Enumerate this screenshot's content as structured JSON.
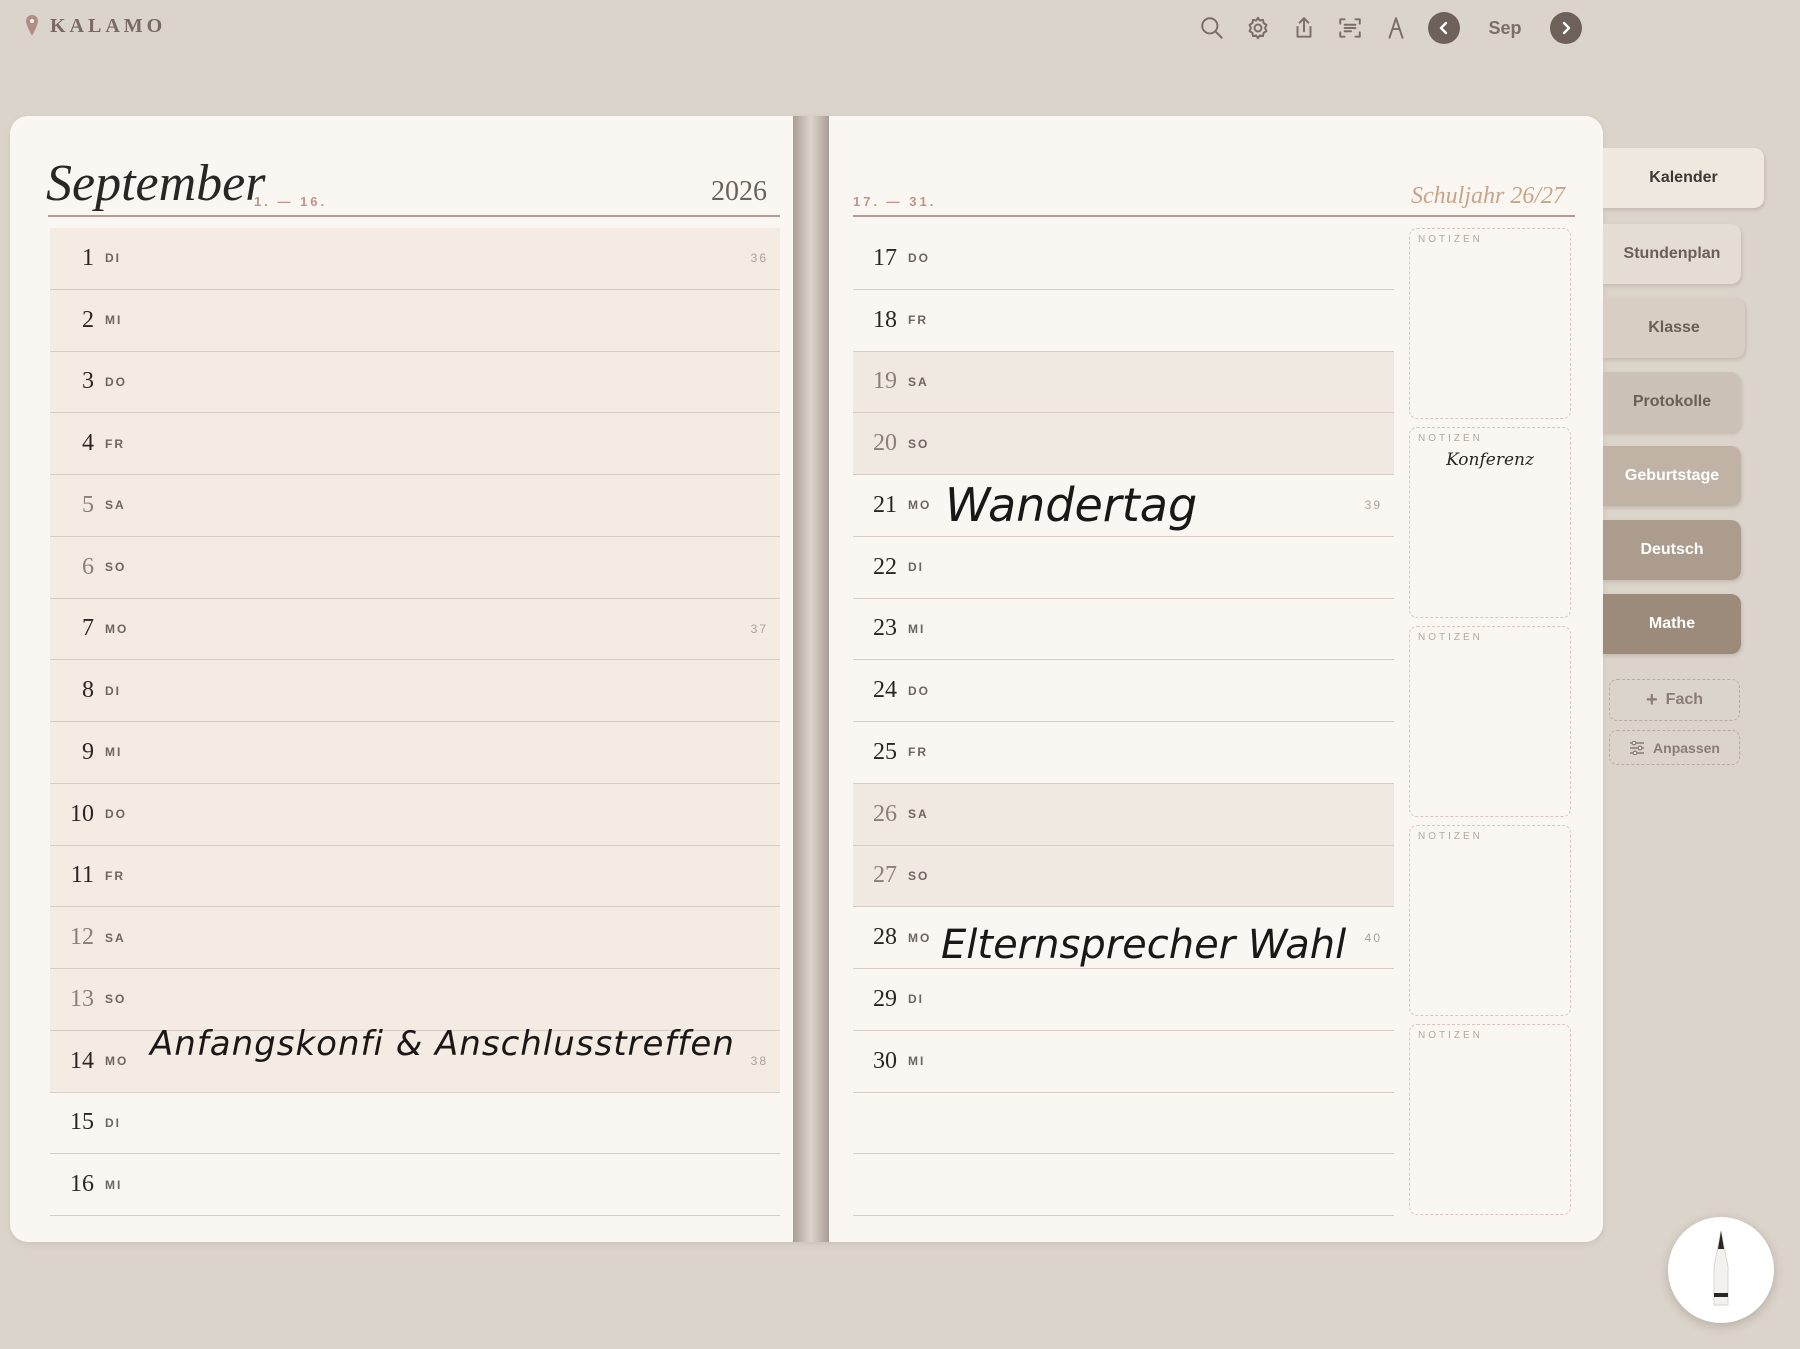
{
  "app": {
    "name": "KALAMO"
  },
  "toolbar": {
    "icons": [
      "search-icon",
      "settings-icon",
      "share-icon",
      "scan-icon",
      "pen-icon"
    ],
    "month": "Sep"
  },
  "left_page": {
    "month_title": "September",
    "range": "1. — 16.",
    "year": "2026",
    "days": [
      {
        "num": "1",
        "wd": "DI",
        "week": "36"
      },
      {
        "num": "2",
        "wd": "MI"
      },
      {
        "num": "3",
        "wd": "DO"
      },
      {
        "num": "4",
        "wd": "FR"
      },
      {
        "num": "5",
        "wd": "SA"
      },
      {
        "num": "6",
        "wd": "SO"
      },
      {
        "num": "7",
        "wd": "MO",
        "week": "37"
      },
      {
        "num": "8",
        "wd": "DI"
      },
      {
        "num": "9",
        "wd": "MI"
      },
      {
        "num": "10",
        "wd": "DO"
      },
      {
        "num": "11",
        "wd": "FR"
      },
      {
        "num": "12",
        "wd": "SA"
      },
      {
        "num": "13",
        "wd": "SO"
      },
      {
        "num": "14",
        "wd": "MO",
        "week": "38"
      },
      {
        "num": "15",
        "wd": "DI"
      },
      {
        "num": "16",
        "wd": "MI"
      }
    ],
    "handwriting_14": "Anfangskonfi & Anschlusstreffen"
  },
  "right_page": {
    "range": "17. — 31.",
    "school_year": "Schuljahr 26/27",
    "days": [
      {
        "num": "17",
        "wd": "DO"
      },
      {
        "num": "18",
        "wd": "FR"
      },
      {
        "num": "19",
        "wd": "SA"
      },
      {
        "num": "20",
        "wd": "SO"
      },
      {
        "num": "21",
        "wd": "MO",
        "week": "39"
      },
      {
        "num": "22",
        "wd": "DI"
      },
      {
        "num": "23",
        "wd": "MI"
      },
      {
        "num": "24",
        "wd": "DO"
      },
      {
        "num": "25",
        "wd": "FR"
      },
      {
        "num": "26",
        "wd": "SA"
      },
      {
        "num": "27",
        "wd": "SO"
      },
      {
        "num": "28",
        "wd": "MO",
        "week": "40"
      },
      {
        "num": "29",
        "wd": "DI"
      },
      {
        "num": "30",
        "wd": "MI"
      }
    ],
    "handwriting_21": "Wandertag",
    "handwriting_28": "Elternsprecher Wahl",
    "notes_label": "NOTIZEN",
    "notes_2_text": "Konferenz"
  },
  "tabs": [
    "Kalender",
    "Stundenplan",
    "Klasse",
    "Protokolle",
    "Geburtstage",
    "Deutsch",
    "Mathe"
  ],
  "tab_colors": [
    "#efe8de",
    "#e4ddd3",
    "#d8cec4",
    "#cdc2b8",
    "#c0b2a5",
    "#ac9c8d",
    "#9c8a7b"
  ],
  "add_subject": "Fach",
  "customize": "Anpassen"
}
